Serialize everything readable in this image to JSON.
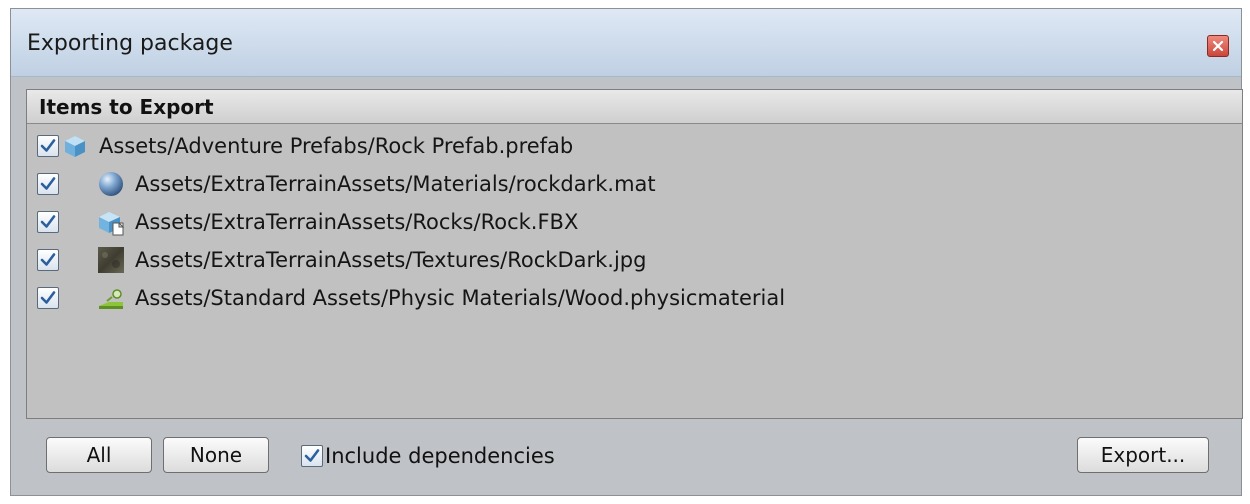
{
  "window": {
    "title": "Exporting package"
  },
  "list": {
    "header": "Items to Export",
    "items": [
      {
        "path": "Assets/Adventure Prefabs/Rock Prefab.prefab",
        "checked": true,
        "icon": "prefab-cube-icon"
      },
      {
        "path": "Assets/ExtraTerrainAssets/Materials/rockdark.mat",
        "checked": true,
        "icon": "material-sphere-icon"
      },
      {
        "path": "Assets/ExtraTerrainAssets/Rocks/Rock.FBX",
        "checked": true,
        "icon": "model-mesh-icon"
      },
      {
        "path": "Assets/ExtraTerrainAssets/Textures/RockDark.jpg",
        "checked": true,
        "icon": "texture-thumbnail-icon"
      },
      {
        "path": "Assets/Standard Assets/Physic Materials/Wood.physicmaterial",
        "checked": true,
        "icon": "physic-material-icon"
      }
    ]
  },
  "footer": {
    "all_label": "All",
    "none_label": "None",
    "include_dependencies_label": "Include dependencies",
    "include_dependencies_checked": true,
    "export_label": "Export..."
  },
  "colors": {
    "titlebar": "#cddbeb",
    "panel": "#c1c1c1",
    "checkmark": "#2b5f9e",
    "close_button": "#c9473a"
  }
}
